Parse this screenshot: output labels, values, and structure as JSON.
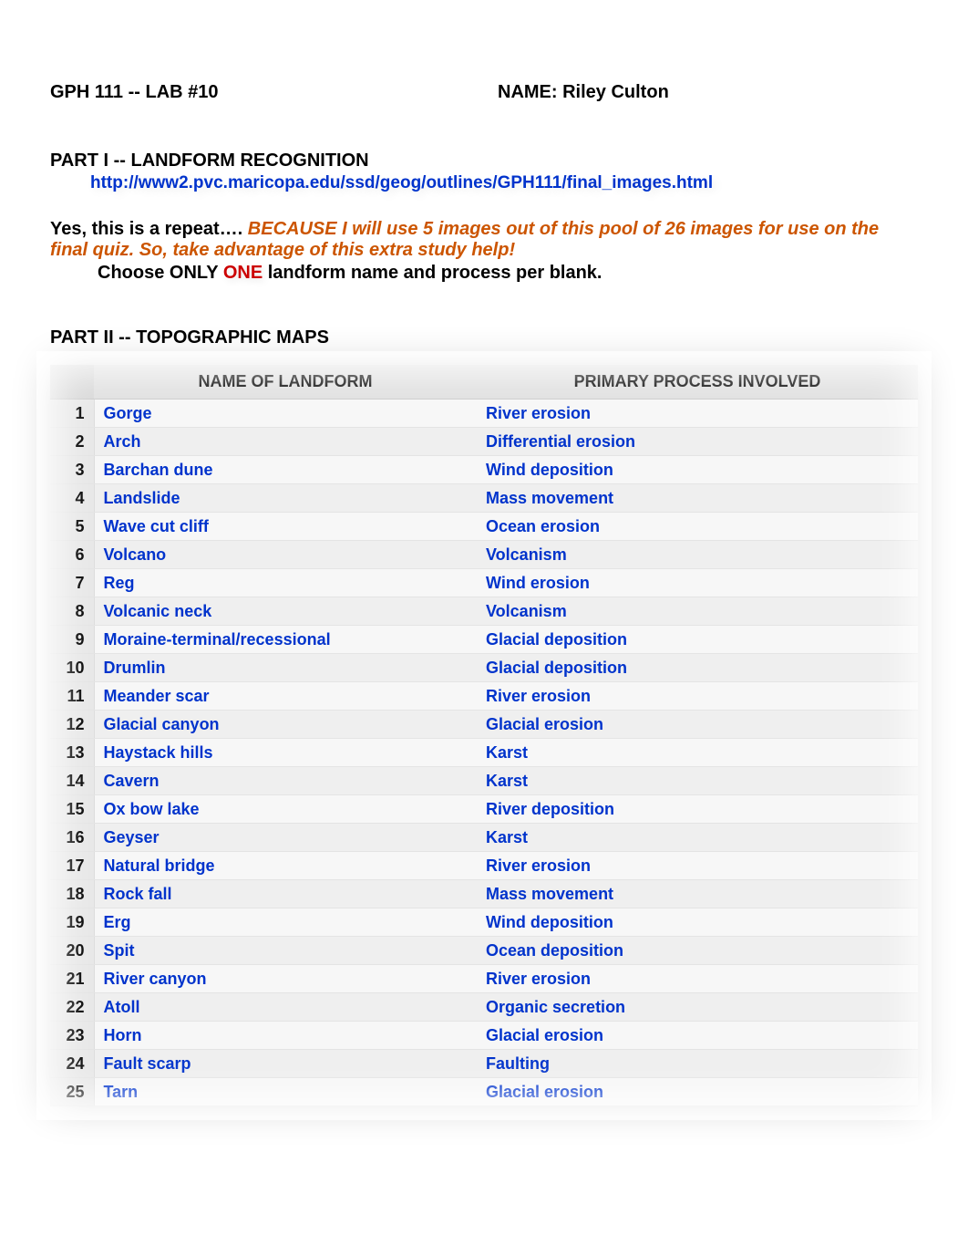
{
  "header": {
    "lab_title": "GPH 111 -- LAB #10",
    "name_prefix": "NAME:  ",
    "name_value": "Riley Culton"
  },
  "part1": {
    "title": "PART I  --  LANDFORM RECOGNITION",
    "url": "http://www2.pvc.maricopa.edu/ssd/geog/outlines/GPH111/final_images.html",
    "repeat_black": "Yes, this is a repeat…. ",
    "repeat_orange": "BECAUSE I will use 5 images out of this pool of 26 images for use on the final quiz.  So, take advantage of this extra study help!",
    "choose_before": "Choose ONLY ",
    "choose_one": "ONE",
    "choose_after": " landform name and process per blank."
  },
  "part2": {
    "title": "PART II  --  TOPOGRAPHIC MAPS"
  },
  "table": {
    "col_name": "NAME OF LANDFORM",
    "col_process": "PRIMARY PROCESS INVOLVED",
    "rows": [
      {
        "n": "1",
        "name": "Gorge",
        "process": "River erosion"
      },
      {
        "n": "2",
        "name": "Arch",
        "process": "Differential erosion"
      },
      {
        "n": "3",
        "name": "Barchan dune",
        "process": "Wind deposition"
      },
      {
        "n": "4",
        "name": "Landslide",
        "process": "Mass movement"
      },
      {
        "n": "5",
        "name": "Wave cut cliff",
        "process": "Ocean erosion"
      },
      {
        "n": "6",
        "name": "Volcano",
        "process": "Volcanism"
      },
      {
        "n": "7",
        "name": "Reg",
        "process": "Wind erosion"
      },
      {
        "n": "8",
        "name": "Volcanic neck",
        "process": "Volcanism"
      },
      {
        "n": "9",
        "name": "Moraine-terminal/recessional",
        "process": "Glacial deposition"
      },
      {
        "n": "10",
        "name": "Drumlin",
        "process": "Glacial deposition"
      },
      {
        "n": "11",
        "name": "Meander scar",
        "process": "River erosion"
      },
      {
        "n": "12",
        "name": "Glacial canyon",
        "process": "Glacial erosion"
      },
      {
        "n": "13",
        "name": "Haystack hills",
        "process": "Karst"
      },
      {
        "n": "14",
        "name": "Cavern",
        "process": "Karst"
      },
      {
        "n": "15",
        "name": "Ox bow lake",
        "process": "River deposition"
      },
      {
        "n": "16",
        "name": "Geyser",
        "process": "Karst"
      },
      {
        "n": "17",
        "name": "Natural bridge",
        "process": "River erosion"
      },
      {
        "n": "18",
        "name": "Rock fall",
        "process": "Mass movement"
      },
      {
        "n": "19",
        "name": "Erg",
        "process": "Wind deposition"
      },
      {
        "n": "20",
        "name": "Spit",
        "process": "Ocean deposition"
      },
      {
        "n": "21",
        "name": "River canyon",
        "process": "River erosion"
      },
      {
        "n": "22",
        "name": "Atoll",
        "process": "Organic secretion"
      },
      {
        "n": "23",
        "name": "Horn",
        "process": "Glacial erosion"
      },
      {
        "n": "24",
        "name": "Fault scarp",
        "process": "Faulting"
      },
      {
        "n": "25",
        "name": "Tarn",
        "process": "Glacial erosion"
      }
    ]
  }
}
